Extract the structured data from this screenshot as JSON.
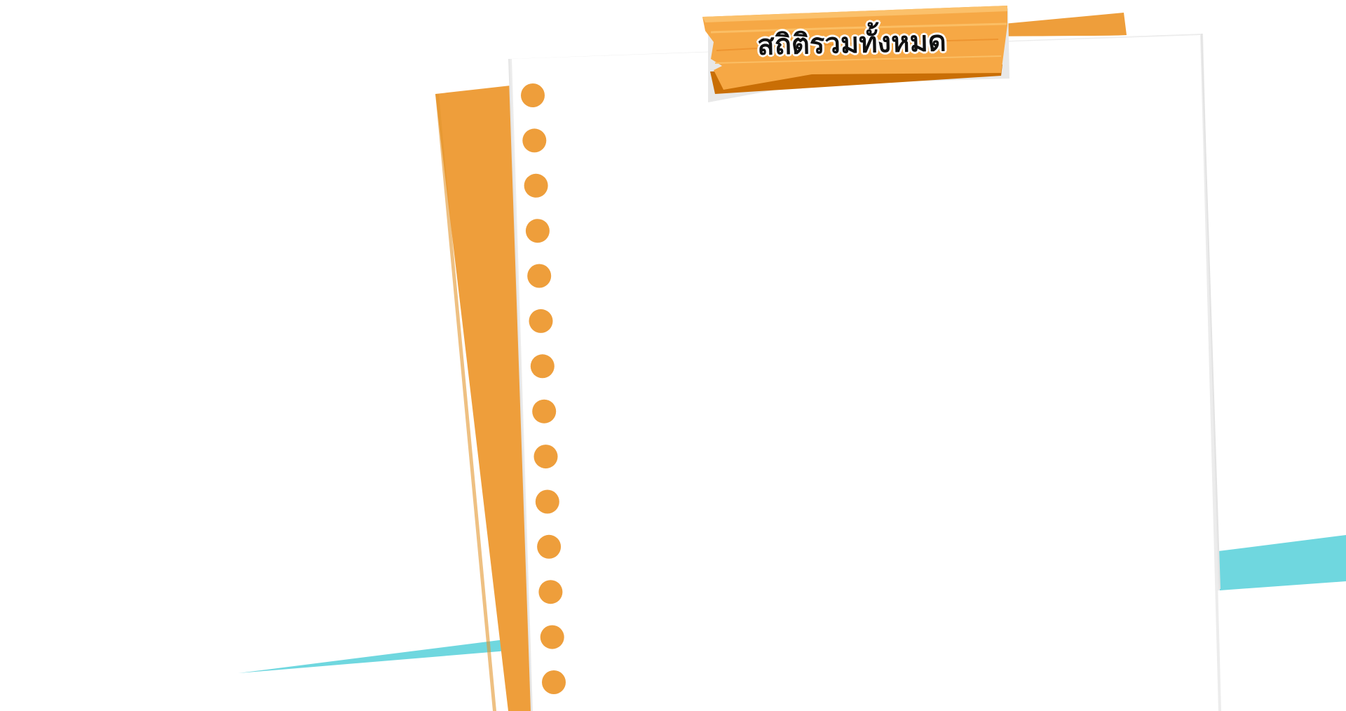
{
  "stats_panel": {
    "title": "สถิติรวมทั้งหมด"
  },
  "colors": {
    "orange": "#EE9E3B",
    "orange_light": "#F6A845",
    "orange_dark": "#C96E05",
    "teal": "#6FD7DF",
    "paper": "#FFFFFF",
    "paper_edge": "#E6E6E6"
  },
  "decor": {
    "binder_hole_count": 14
  }
}
